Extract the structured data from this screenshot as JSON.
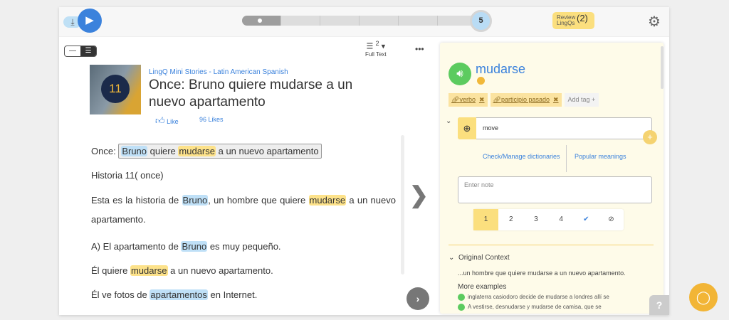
{
  "player": {
    "level": "5",
    "review_label": "Review LingQs",
    "review_count": "(2)",
    "progress_segments": 6,
    "progress_done": 1
  },
  "toolbar": {
    "full_text": "Full Text",
    "badge": "2",
    "more": "•••"
  },
  "lesson": {
    "cover_number": "11",
    "course": "LingQ Mini Stories - Latin American Spanish",
    "title": "Once: Bruno quiere mudarse a un nuevo apartamento",
    "like": "Like",
    "likes": "96 Likes"
  },
  "text": {
    "l1": [
      "Once:",
      "Bruno",
      "quiere",
      "mudarse",
      "a un nuevo apartamento"
    ],
    "l2": "Historia 11( once)",
    "l3": [
      "Esta es la historia de",
      "Bruno",
      ", un hombre que quiere",
      "mudarse",
      "a un nuevo apartamento."
    ],
    "l4": [
      "A) El apartamento de",
      "Bruno",
      "es muy pequeño."
    ],
    "l5": [
      "Él quiere",
      "mudarse",
      "a un nuevo apartamento."
    ],
    "l6": [
      "Él ve fotos de",
      "apartamentos",
      "en Internet."
    ]
  },
  "panel": {
    "word": "mudarse",
    "tags": [
      "verbo",
      "participio pasado"
    ],
    "add_tag": "Add tag +",
    "meaning": "move",
    "check_dict": "Check/Manage dictionaries",
    "popular": "Popular meanings",
    "note_placeholder": "Enter note",
    "status": [
      "1",
      "2",
      "3",
      "4",
      "✔",
      "⊘"
    ],
    "original_context": "Original Context",
    "context": "...un hombre que quiere mudarse a un nuevo apartamento.",
    "more_examples": "More examples",
    "examples": [
      "inglaterra casiodoro decide de mudarse a londres allí se",
      "A vestirse, desnudarse y mudarse de camisa, que se"
    ]
  },
  "help": "?"
}
